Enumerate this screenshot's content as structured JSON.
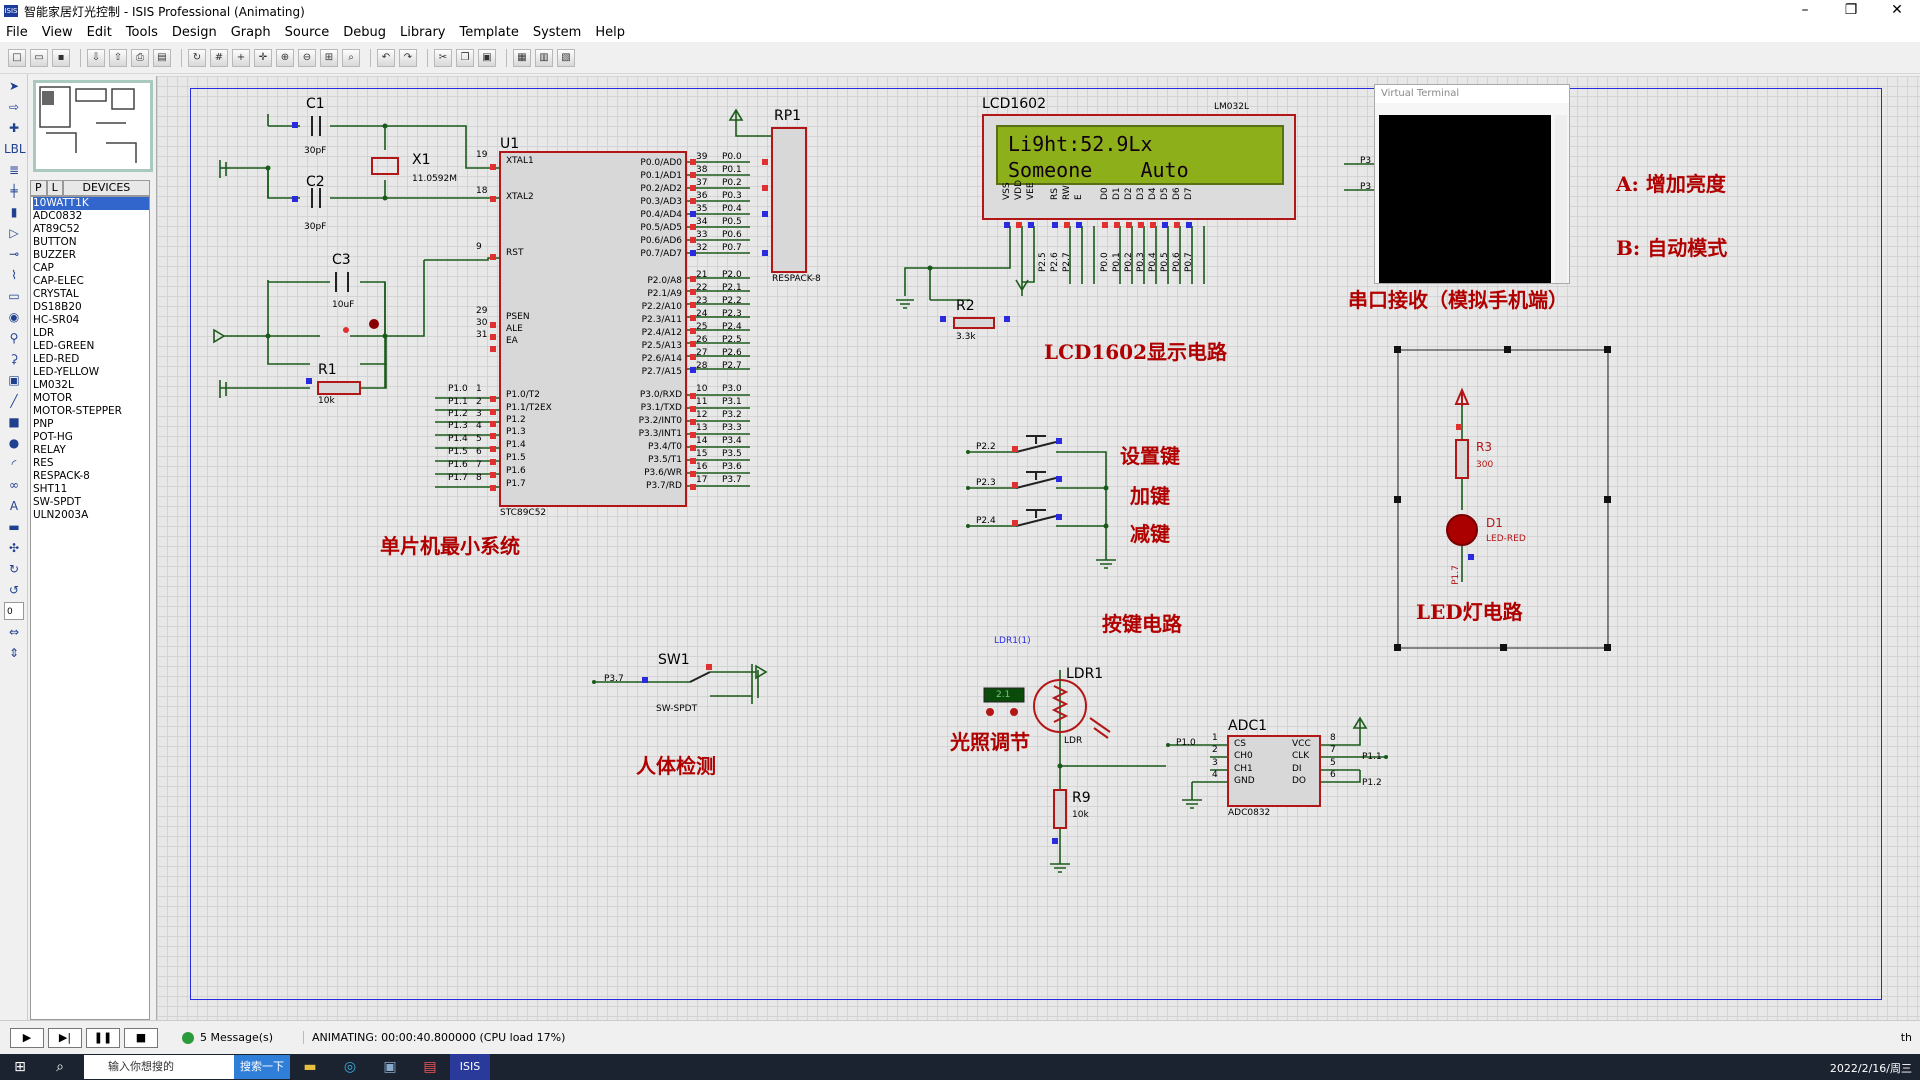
{
  "window": {
    "title": "智能家居灯光控制 - ISIS Professional (Animating)",
    "minimize": "–",
    "restore": "❐",
    "close": "✕"
  },
  "menu": [
    "File",
    "View",
    "Edit",
    "Tools",
    "Design",
    "Graph",
    "Source",
    "Debug",
    "Library",
    "Template",
    "System",
    "Help"
  ],
  "device_panel": {
    "tab_p": "P",
    "tab_l": "L",
    "tab_devices": "DEVICES",
    "items": [
      "10WATT1K",
      "ADC0832",
      "AT89C52",
      "BUTTON",
      "BUZZER",
      "CAP",
      "CAP-ELEC",
      "CRYSTAL",
      "DS18B20",
      "HC-SR04",
      "LDR",
      "LED-GREEN",
      "LED-RED",
      "LED-YELLOW",
      "LM032L",
      "MOTOR",
      "MOTOR-STEPPER",
      "PNP",
      "POT-HG",
      "RELAY",
      "RES",
      "RESPACK-8",
      "SHT11",
      "SW-SPDT",
      "ULN2003A"
    ],
    "selected": 0
  },
  "schematic": {
    "lcd": {
      "ref": "LCD1602",
      "part": "LM032L",
      "line1": "Li9ht:52.9Lx",
      "line2": "Someone    Auto",
      "pins": [
        "VSS",
        "VDD",
        "VEE",
        "RS",
        "RW",
        "E",
        "D0",
        "D1",
        "D2",
        "D3",
        "D4",
        "D5",
        "D6",
        "D7"
      ],
      "nets": [
        "P2.5",
        "P2.6",
        "P2.7",
        "P0.0",
        "P0.1",
        "P0.2",
        "P0.3",
        "P0.4",
        "P0.5",
        "P0.6",
        "P0.7"
      ]
    },
    "mcu": {
      "ref": "U1",
      "part": "STC89C52",
      "left_pins": [
        "XTAL1",
        "XTAL2",
        "RST",
        "PSEN",
        "ALE",
        "EA",
        "P1.0/T2",
        "P1.1/T2EX",
        "P1.2",
        "P1.3",
        "P1.4",
        "P1.5",
        "P1.6",
        "P1.7"
      ],
      "left_nums": [
        "19",
        "18",
        "9",
        "29",
        "30",
        "31",
        "1",
        "2",
        "3",
        "4",
        "5",
        "6",
        "7",
        "8"
      ],
      "right_pins": [
        "P0.0/AD0",
        "P0.1/AD1",
        "P0.2/AD2",
        "P0.3/AD3",
        "P0.4/AD4",
        "P0.5/AD5",
        "P0.6/AD6",
        "P0.7/AD7",
        "P2.0/A8",
        "P2.1/A9",
        "P2.2/A10",
        "P2.3/A11",
        "P2.4/A12",
        "P2.5/A13",
        "P2.6/A14",
        "P2.7/A15",
        "P3.0/RXD",
        "P3.1/TXD",
        "P3.2/INT0",
        "P3.3/INT1",
        "P3.4/T0",
        "P3.5/T1",
        "P3.6/WR",
        "P3.7/RD"
      ],
      "right_nums": [
        "39",
        "38",
        "37",
        "36",
        "35",
        "34",
        "33",
        "32",
        "21",
        "22",
        "23",
        "24",
        "25",
        "26",
        "27",
        "28",
        "10",
        "11",
        "12",
        "13",
        "14",
        "15",
        "16",
        "17"
      ],
      "right_nets": [
        "P0.0",
        "P0.1",
        "P0.2",
        "P0.3",
        "P0.4",
        "P0.5",
        "P0.6",
        "P0.7",
        "P2.0",
        "P2.1",
        "P2.2",
        "P2.3",
        "P2.4",
        "P2.5",
        "P2.6",
        "P2.7",
        "P3.0",
        "P3.1",
        "P3.2",
        "P3.3",
        "P3.4",
        "P3.5",
        "P3.6",
        "P3.7"
      ],
      "left_nets": [
        "P1.0",
        "P1.1",
        "P1.2",
        "P1.3",
        "P1.4",
        "P1.5",
        "P1.6",
        "P1.7"
      ]
    },
    "c1": {
      "ref": "C1",
      "val": "30pF"
    },
    "c2": {
      "ref": "C2",
      "val": "30pF"
    },
    "c3": {
      "ref": "C3",
      "val": "10uF"
    },
    "x1": {
      "ref": "X1",
      "val": "11.0592M"
    },
    "r1": {
      "ref": "R1",
      "val": "10k"
    },
    "r2": {
      "ref": "R2",
      "val": "3.3k"
    },
    "r3": {
      "ref": "R3",
      "val": "300"
    },
    "r9": {
      "ref": "R9",
      "val": "10k"
    },
    "rp1": {
      "ref": "RP1",
      "part": "RESPACK-8"
    },
    "d1": {
      "ref": "D1",
      "part": "LED-RED",
      "net": "P1.7"
    },
    "sw1": {
      "ref": "SW1",
      "part": "SW-SPDT",
      "net": "P3.7"
    },
    "ldr1": {
      "ref": "LDR1",
      "part": "LDR",
      "probe": "LDR1(1)",
      "reading": "2.1"
    },
    "adc": {
      "ref": "ADC1",
      "part": "ADC0832",
      "pins_left": [
        "CS",
        "CH0",
        "CH1",
        "GND"
      ],
      "nums_left": [
        "1",
        "2",
        "3",
        "4"
      ],
      "pins_right": [
        "VCC",
        "CLK",
        "DI",
        "DO"
      ],
      "nums_right": [
        "8",
        "7",
        "5",
        "6"
      ],
      "nets": [
        "P1.0",
        "P1.1",
        "P1.2"
      ]
    },
    "buttons": [
      "P2.2",
      "P2.3",
      "P2.4"
    ],
    "serial_nets": [
      "P3",
      "P3"
    ],
    "labels": {
      "mcu_min": "单片机最小系统",
      "lcd_circuit": "LCD1602显示电路",
      "set_key": "设置键",
      "plus_key": "加键",
      "minus_key": "减键",
      "key_circuit": "按键电路",
      "light_adjust": "光照调节",
      "human_detect": "人体检测",
      "serial_recv": "串口接收（模拟手机端）",
      "led_circuit": "LED灯电路",
      "a_key": "A:  增加亮度",
      "b_key": "B:  自动模式"
    },
    "virtual_terminal": "Virtual Terminal"
  },
  "status": {
    "messages": "5 Message(s)",
    "animating": "ANIMATING: 00:00:40.800000 (CPU load 17%)",
    "corner": "th"
  },
  "taskbar": {
    "search_placeholder": "输入你想搜的",
    "search_button": "搜索一下",
    "isis": "ISIS",
    "clock": "2022/2/16/周三"
  },
  "colors": {
    "wire": "#1a5a1a",
    "part": "#b21616",
    "label": "#b00000",
    "sheet_border": "#2a2adf"
  }
}
